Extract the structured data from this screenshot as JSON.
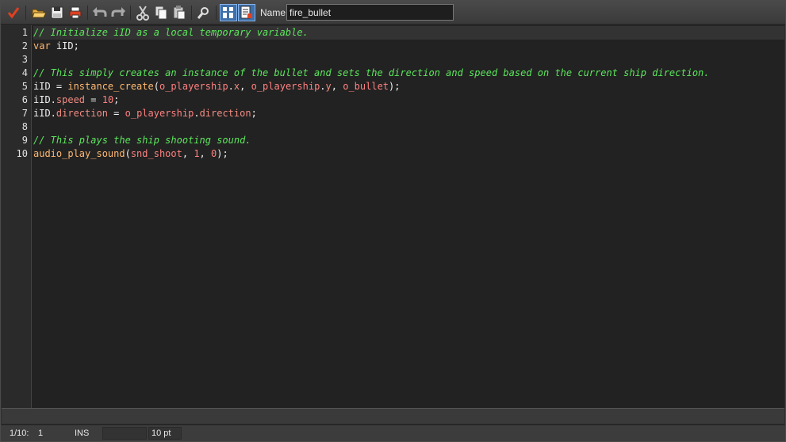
{
  "toolbar": {
    "buttons": [
      {
        "id": "ok",
        "icon": "checkmark-icon"
      },
      {
        "id": "open",
        "icon": "open-folder-icon"
      },
      {
        "id": "save",
        "icon": "save-disk-icon"
      },
      {
        "id": "print",
        "icon": "print-icon"
      },
      {
        "id": "undo",
        "icon": "undo-icon"
      },
      {
        "id": "redo",
        "icon": "redo-icon"
      },
      {
        "id": "cut",
        "icon": "scissors-icon"
      },
      {
        "id": "copy",
        "icon": "copy-icon"
      },
      {
        "id": "paste",
        "icon": "paste-icon"
      },
      {
        "id": "find",
        "icon": "magnifier-icon"
      },
      {
        "id": "show-functions",
        "icon": "function-list-icon"
      },
      {
        "id": "show-snippets",
        "icon": "snippet-icon"
      }
    ],
    "name_label": "Name:",
    "name_value": "fire_bullet"
  },
  "editor": {
    "line_numbers": [
      "1",
      "2",
      "3",
      "4",
      "5",
      "6",
      "7",
      "8",
      "9",
      "10"
    ],
    "current_line": 1,
    "lines": [
      [
        {
          "t": "// Initialize iID as a local temporary variable.",
          "c": "cm"
        }
      ],
      [
        {
          "t": "var",
          "c": "kw"
        },
        {
          "t": " iID;",
          "c": "id"
        }
      ],
      [],
      [
        {
          "t": "// This simply creates an instance of the bullet and sets the direction and speed based on the current ship direction.",
          "c": "cm"
        }
      ],
      [
        {
          "t": "iID = ",
          "c": "id"
        },
        {
          "t": "instance_create",
          "c": "fn"
        },
        {
          "t": "(",
          "c": "id"
        },
        {
          "t": "o_playership",
          "c": "obj"
        },
        {
          "t": ".",
          "c": "id"
        },
        {
          "t": "x",
          "c": "var"
        },
        {
          "t": ", ",
          "c": "id"
        },
        {
          "t": "o_playership",
          "c": "obj"
        },
        {
          "t": ".",
          "c": "id"
        },
        {
          "t": "y",
          "c": "var"
        },
        {
          "t": ", ",
          "c": "id"
        },
        {
          "t": "o_bullet",
          "c": "obj"
        },
        {
          "t": ");",
          "c": "id"
        }
      ],
      [
        {
          "t": "iID.",
          "c": "id"
        },
        {
          "t": "speed",
          "c": "var"
        },
        {
          "t": " = ",
          "c": "id"
        },
        {
          "t": "10",
          "c": "num"
        },
        {
          "t": ";",
          "c": "id"
        }
      ],
      [
        {
          "t": "iID.",
          "c": "id"
        },
        {
          "t": "direction",
          "c": "var"
        },
        {
          "t": " = ",
          "c": "id"
        },
        {
          "t": "o_playership",
          "c": "obj"
        },
        {
          "t": ".",
          "c": "id"
        },
        {
          "t": "direction",
          "c": "var"
        },
        {
          "t": ";",
          "c": "id"
        }
      ],
      [],
      [
        {
          "t": "// This plays the ship shooting sound.",
          "c": "cm"
        }
      ],
      [
        {
          "t": "audio_play_sound",
          "c": "fn"
        },
        {
          "t": "(",
          "c": "id"
        },
        {
          "t": "snd_shoot",
          "c": "res"
        },
        {
          "t": ", ",
          "c": "id"
        },
        {
          "t": "1",
          "c": "num"
        },
        {
          "t": ", ",
          "c": "id"
        },
        {
          "t": "0",
          "c": "num"
        },
        {
          "t": ");",
          "c": "id"
        }
      ]
    ]
  },
  "status": {
    "position": "1/10:",
    "column": "1",
    "mode": "INS",
    "font_size": "10 pt"
  },
  "colors": {
    "comment": "#5ce65c",
    "keyword": "#ffb871",
    "number": "#ff8080",
    "background": "#222222"
  }
}
